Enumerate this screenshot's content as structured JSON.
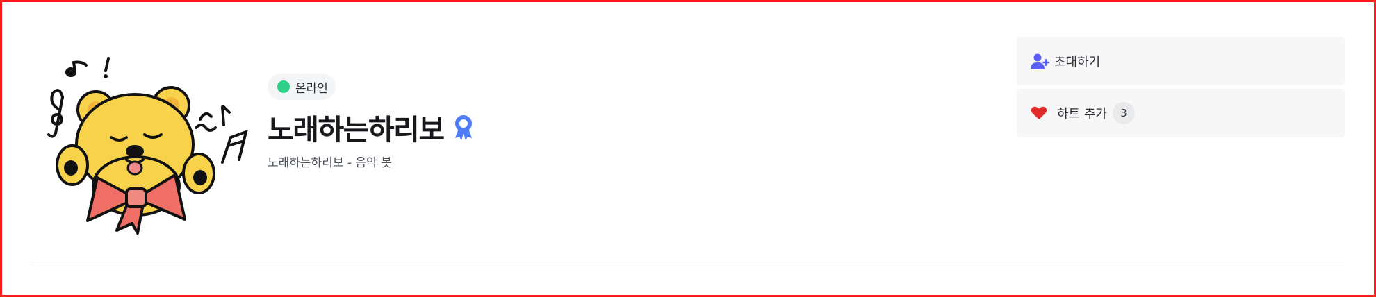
{
  "profile": {
    "status": "온라인",
    "name": "노래하는하리보",
    "subtitle": "노래하는하리보 - 음악 봇"
  },
  "actions": {
    "invite_label": "초대하기",
    "heart_label": "하트 추가",
    "heart_count": "3"
  },
  "icons": {
    "status": "online-dot-icon",
    "badge": "award-ribbon-icon",
    "invite": "user-plus-icon",
    "heart": "heart-icon"
  },
  "colors": {
    "online": "#2dd086",
    "badge": "#4f7cf7",
    "invite_icon": "#5c5ff5",
    "heart": "#e32b2b",
    "frame_border": "#ff1d1d"
  }
}
